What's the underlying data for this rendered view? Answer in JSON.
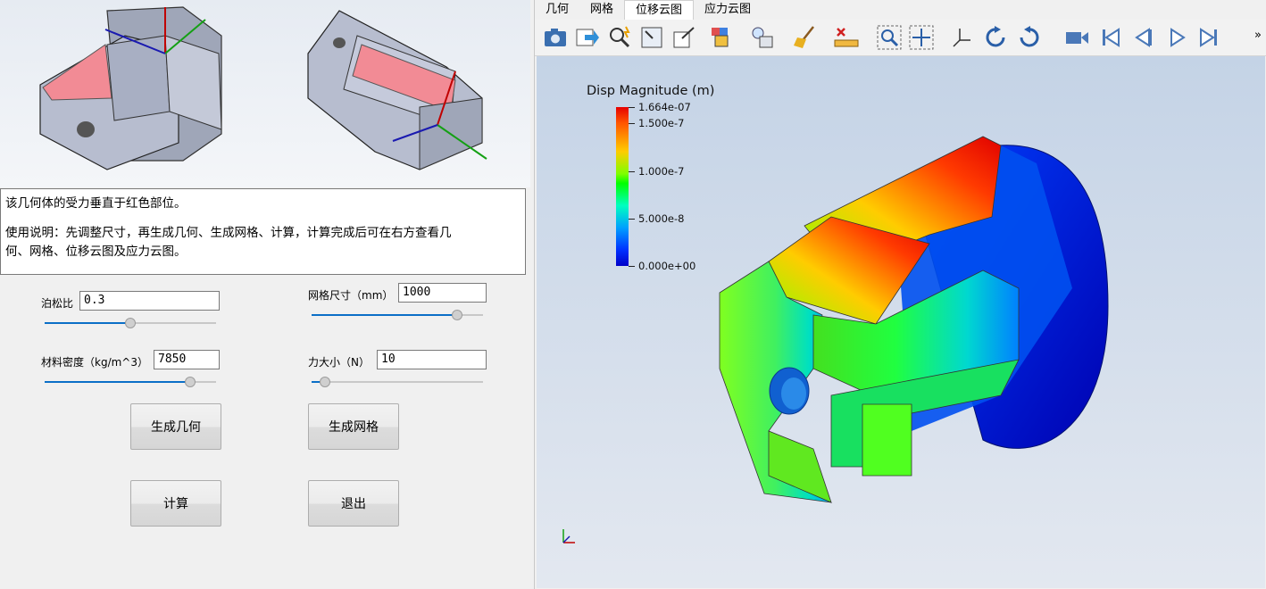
{
  "description": {
    "line1": "该几何体的受力垂直于红色部位。",
    "line2": "使用说明：先调整尺寸，再生成几何、生成网格、计算，计算完成后可在右方查看几",
    "line3": "何、网格、位移云图及应力云图。"
  },
  "params": {
    "poisson": {
      "label": "泊松比",
      "value": "0.3",
      "level": 0.5
    },
    "mesh_size": {
      "label": "网格尺寸（mm）",
      "value": "1000",
      "level": 0.85
    },
    "density": {
      "label": "材料密度（kg/m^3）",
      "value": "7850",
      "level": 0.85
    },
    "force": {
      "label": "力大小（N）",
      "value": "10",
      "level": 0.08
    }
  },
  "buttons": {
    "gen_geometry": "生成几何",
    "gen_mesh": "生成网格",
    "compute": "计算",
    "exit": "退出"
  },
  "tabs": [
    "几何",
    "网格",
    "位移云图",
    "应力云图"
  ],
  "active_tab": "位移云图",
  "toolbar": {
    "icons": [
      "camera-icon",
      "export-icon",
      "zoom-pick-icon",
      "fit-box-icon",
      "box-icon",
      "color-box-icon",
      "lightbulb-icon",
      "broom-icon",
      "ruler-x-icon",
      "zoom-region-icon",
      "fit-all-icon",
      "axes-icon",
      "rotate-cw-icon",
      "rotate-ccw-icon",
      "video-camera-icon",
      "first-frame-icon",
      "prev-frame-icon",
      "play-icon",
      "last-frame-icon"
    ],
    "overflow": "»"
  },
  "legend": {
    "title": "Disp Magnitude (m)",
    "labels": [
      "1.664e-07",
      "1.500e-7",
      "1.000e-7",
      "5.000e-8",
      "0.000e+00"
    ]
  },
  "colors": {
    "accent": "#0b6fc7",
    "highlight_face": "#f28b95",
    "max": "#e60000",
    "min": "#0000c8"
  }
}
